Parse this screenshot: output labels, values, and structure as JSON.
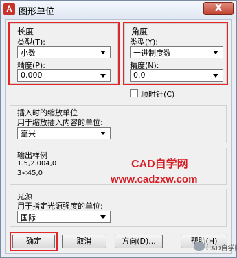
{
  "window": {
    "title": "图形单位",
    "app_icon": "A",
    "close": "X"
  },
  "length": {
    "heading": "长度",
    "type_label": "类型(T):",
    "type_value": "小数",
    "precision_label": "精度(P):",
    "precision_value": "0.000"
  },
  "angle": {
    "heading": "角度",
    "type_label": "类型(Y):",
    "type_value": "十进制度数",
    "precision_label": "精度(N):",
    "precision_value": "0.0",
    "clockwise_label": "顺时针(C)",
    "clockwise_checked": false
  },
  "insertion": {
    "heading": "插入时的缩放单位",
    "desc": "用于缩放插入内容的单位:",
    "value": "毫米"
  },
  "sample": {
    "heading": "输出样例",
    "line1": "1.5,2.004,0",
    "line2": "3<45,0"
  },
  "lighting": {
    "heading": "光源",
    "desc": "用于指定光源强度的单位:",
    "value": "国际"
  },
  "buttons": {
    "ok": "确定",
    "cancel": "取消",
    "direction": "方向(D)...",
    "help": "帮助(H)"
  },
  "watermark": {
    "name": "CAD自学网",
    "url": "www.cadzxw.com",
    "badge": "CAD自学网"
  },
  "colors": {
    "highlight": "#e3262a",
    "watermark": "#d41f26"
  }
}
